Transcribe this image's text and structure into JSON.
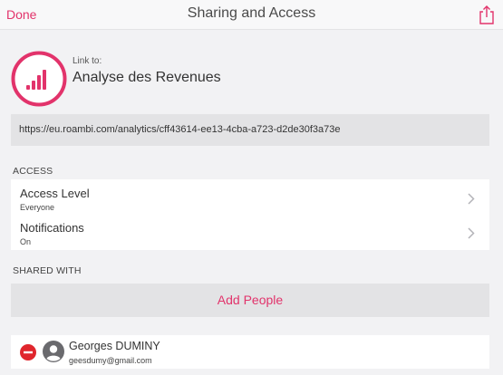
{
  "header": {
    "done_label": "Done",
    "title": "Sharing and Access",
    "share_icon": "share-icon"
  },
  "link": {
    "label": "Link to:",
    "dashboard_name": "Analyse des Revenues",
    "url": "https://eu.roambi.com/analytics/cff43614-ee13-4cba-a723-d2de30f3a73e",
    "logo_icon": "roambi-logo-icon"
  },
  "access": {
    "section_title": "ACCESS",
    "rows": [
      {
        "label": "Access Level",
        "value": "Everyone"
      },
      {
        "label": "Notifications",
        "value": "On"
      }
    ]
  },
  "shared_with": {
    "section_title": "SHARED WITH",
    "add_people_label": "Add People",
    "users": [
      {
        "name": "Georges DUMINY",
        "email": "geesdumy@gmail.com"
      }
    ]
  },
  "colors": {
    "accent": "#e2336b",
    "background": "#f2f2f4",
    "field_background": "#e3e3e5",
    "remove": "#e0262d"
  }
}
